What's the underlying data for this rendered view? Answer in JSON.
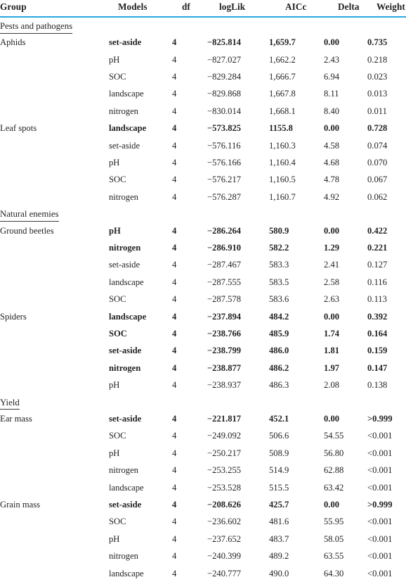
{
  "table": {
    "columns": [
      {
        "key": "group",
        "label": "Group"
      },
      {
        "key": "models",
        "label": "Models"
      },
      {
        "key": "df",
        "label": "df"
      },
      {
        "key": "loglik",
        "label": "logLik"
      },
      {
        "key": "aicc",
        "label": "AICc"
      },
      {
        "key": "delta",
        "label": "Delta"
      },
      {
        "key": "weight",
        "label": "Weight"
      }
    ],
    "rule_color": "#29a8e0",
    "sections": [
      {
        "title": "Pests and pathogens",
        "rows": [
          {
            "group": "Aphids",
            "models": "set-aside",
            "df": "4",
            "loglik": "−825.814",
            "aicc": "1,659.7",
            "delta": "0.00",
            "weight": "0.735",
            "bold": true
          },
          {
            "group": "",
            "models": "pH",
            "df": "4",
            "loglik": "−827.027",
            "aicc": "1,662.2",
            "delta": "2.43",
            "weight": "0.218",
            "bold": false
          },
          {
            "group": "",
            "models": "SOC",
            "df": "4",
            "loglik": "−829.284",
            "aicc": "1,666.7",
            "delta": "6.94",
            "weight": "0.023",
            "bold": false
          },
          {
            "group": "",
            "models": "landscape",
            "df": "4",
            "loglik": "−829.868",
            "aicc": "1,667.8",
            "delta": "8.11",
            "weight": "0.013",
            "bold": false
          },
          {
            "group": "",
            "models": "nitrogen",
            "df": "4",
            "loglik": "−830.014",
            "aicc": "1,668.1",
            "delta": "8.40",
            "weight": "0.011",
            "bold": false
          },
          {
            "group": "Leaf spots",
            "models": "landscape",
            "df": "4",
            "loglik": "−573.825",
            "aicc": "1155.8",
            "delta": "0.00",
            "weight": "0.728",
            "bold": true
          },
          {
            "group": "",
            "models": "set-aside",
            "df": "4",
            "loglik": "−576.116",
            "aicc": "1,160.3",
            "delta": "4.58",
            "weight": "0.074",
            "bold": false
          },
          {
            "group": "",
            "models": "pH",
            "df": "4",
            "loglik": "−576.166",
            "aicc": "1,160.4",
            "delta": "4.68",
            "weight": "0.070",
            "bold": false
          },
          {
            "group": "",
            "models": "SOC",
            "df": "4",
            "loglik": "−576.217",
            "aicc": "1,160.5",
            "delta": "4.78",
            "weight": "0.067",
            "bold": false
          },
          {
            "group": "",
            "models": "nitrogen",
            "df": "4",
            "loglik": "−576.287",
            "aicc": "1,160.7",
            "delta": "4.92",
            "weight": "0.062",
            "bold": false
          }
        ]
      },
      {
        "title": "Natural enemies",
        "rows": [
          {
            "group": "Ground beetles",
            "models": "pH",
            "df": "4",
            "loglik": "−286.264",
            "aicc": "580.9",
            "delta": "0.00",
            "weight": "0.422",
            "bold": true
          },
          {
            "group": "",
            "models": "nitrogen",
            "df": "4",
            "loglik": "−286.910",
            "aicc": "582.2",
            "delta": "1.29",
            "weight": "0.221",
            "bold": true
          },
          {
            "group": "",
            "models": "set-aside",
            "df": "4",
            "loglik": "−287.467",
            "aicc": "583.3",
            "delta": "2.41",
            "weight": "0.127",
            "bold": false
          },
          {
            "group": "",
            "models": "landscape",
            "df": "4",
            "loglik": "−287.555",
            "aicc": "583.5",
            "delta": "2.58",
            "weight": "0.116",
            "bold": false
          },
          {
            "group": "",
            "models": "SOC",
            "df": "4",
            "loglik": "−287.578",
            "aicc": "583.6",
            "delta": "2.63",
            "weight": "0.113",
            "bold": false
          },
          {
            "group": "Spiders",
            "models": "landscape",
            "df": "4",
            "loglik": "−237.894",
            "aicc": "484.2",
            "delta": "0.00",
            "weight": "0.392",
            "bold": true
          },
          {
            "group": "",
            "models": "SOC",
            "df": "4",
            "loglik": "−238.766",
            "aicc": "485.9",
            "delta": "1.74",
            "weight": "0.164",
            "bold": true
          },
          {
            "group": "",
            "models": "set-aside",
            "df": "4",
            "loglik": "−238.799",
            "aicc": "486.0",
            "delta": "1.81",
            "weight": "0.159",
            "bold": true
          },
          {
            "group": "",
            "models": "nitrogen",
            "df": "4",
            "loglik": "−238.877",
            "aicc": "486.2",
            "delta": "1.97",
            "weight": "0.147",
            "bold": true
          },
          {
            "group": "",
            "models": "pH",
            "df": "4",
            "loglik": "−238.937",
            "aicc": "486.3",
            "delta": "2.08",
            "weight": "0.138",
            "bold": false
          }
        ]
      },
      {
        "title": "Yield",
        "rows": [
          {
            "group": "Ear mass",
            "models": "set-aside",
            "df": "4",
            "loglik": "−221.817",
            "aicc": "452.1",
            "delta": "0.00",
            "weight": ">0.999",
            "bold": true
          },
          {
            "group": "",
            "models": "SOC",
            "df": "4",
            "loglik": "−249.092",
            "aicc": "506.6",
            "delta": "54.55",
            "weight": "<0.001",
            "bold": false
          },
          {
            "group": "",
            "models": "pH",
            "df": "4",
            "loglik": "−250.217",
            "aicc": "508.9",
            "delta": "56.80",
            "weight": "<0.001",
            "bold": false
          },
          {
            "group": "",
            "models": "nitrogen",
            "df": "4",
            "loglik": "−253.255",
            "aicc": "514.9",
            "delta": "62.88",
            "weight": "<0.001",
            "bold": false
          },
          {
            "group": "",
            "models": "landscape",
            "df": "4",
            "loglik": "−253.528",
            "aicc": "515.5",
            "delta": "63.42",
            "weight": "<0.001",
            "bold": false
          },
          {
            "group": "Grain mass",
            "models": "set-aside",
            "df": "4",
            "loglik": "−208.626",
            "aicc": "425.7",
            "delta": "0.00",
            "weight": ">0.999",
            "bold": true
          },
          {
            "group": "",
            "models": "SOC",
            "df": "4",
            "loglik": "−236.602",
            "aicc": "481.6",
            "delta": "55.95",
            "weight": "<0.001",
            "bold": false
          },
          {
            "group": "",
            "models": "pH",
            "df": "4",
            "loglik": "−237.652",
            "aicc": "483.7",
            "delta": "58.05",
            "weight": "<0.001",
            "bold": false
          },
          {
            "group": "",
            "models": "nitrogen",
            "df": "4",
            "loglik": "−240.399",
            "aicc": "489.2",
            "delta": "63.55",
            "weight": "<0.001",
            "bold": false
          },
          {
            "group": "",
            "models": "landscape",
            "df": "4",
            "loglik": "−240.777",
            "aicc": "490.0",
            "delta": "64.30",
            "weight": "<0.001",
            "bold": false
          }
        ]
      }
    ]
  }
}
